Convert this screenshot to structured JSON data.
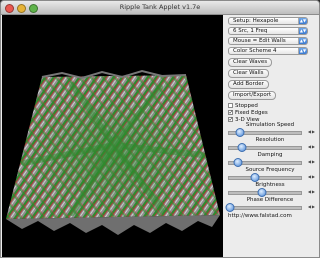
{
  "window": {
    "title": "Ripple Tank Applet v1.7e"
  },
  "colors": {
    "wave_green": "#2e8b2e",
    "wave_red": "#b43c3c",
    "surface": "#9a9a9a",
    "background": "#000000"
  },
  "panel": {
    "setup_select": "Setup: Hexapole",
    "sources_select": "6 Src, 1 Freq",
    "mouse_select": "Mouse = Edit Walls",
    "color_select": "Color Scheme 4",
    "buttons": {
      "clear_waves": "Clear Waves",
      "clear_walls": "Clear Walls",
      "add_border": "Add Border",
      "import_export": "Import/Export"
    },
    "checks": [
      {
        "label": "Stopped",
        "checked": false
      },
      {
        "label": "Fixed Edges",
        "checked": true
      },
      {
        "label": "3-D View",
        "checked": true
      }
    ],
    "sliders": [
      {
        "label": "Simulation Speed",
        "level": 0.15
      },
      {
        "label": "Resolution",
        "level": 0.18
      },
      {
        "label": "Damping",
        "level": 0.12
      },
      {
        "label": "Source Frequency",
        "level": 0.35
      },
      {
        "label": "Brightness",
        "level": 0.45
      },
      {
        "label": "Phase Difference",
        "level": 0.02
      }
    ],
    "url": "http://www.falstad.com"
  }
}
